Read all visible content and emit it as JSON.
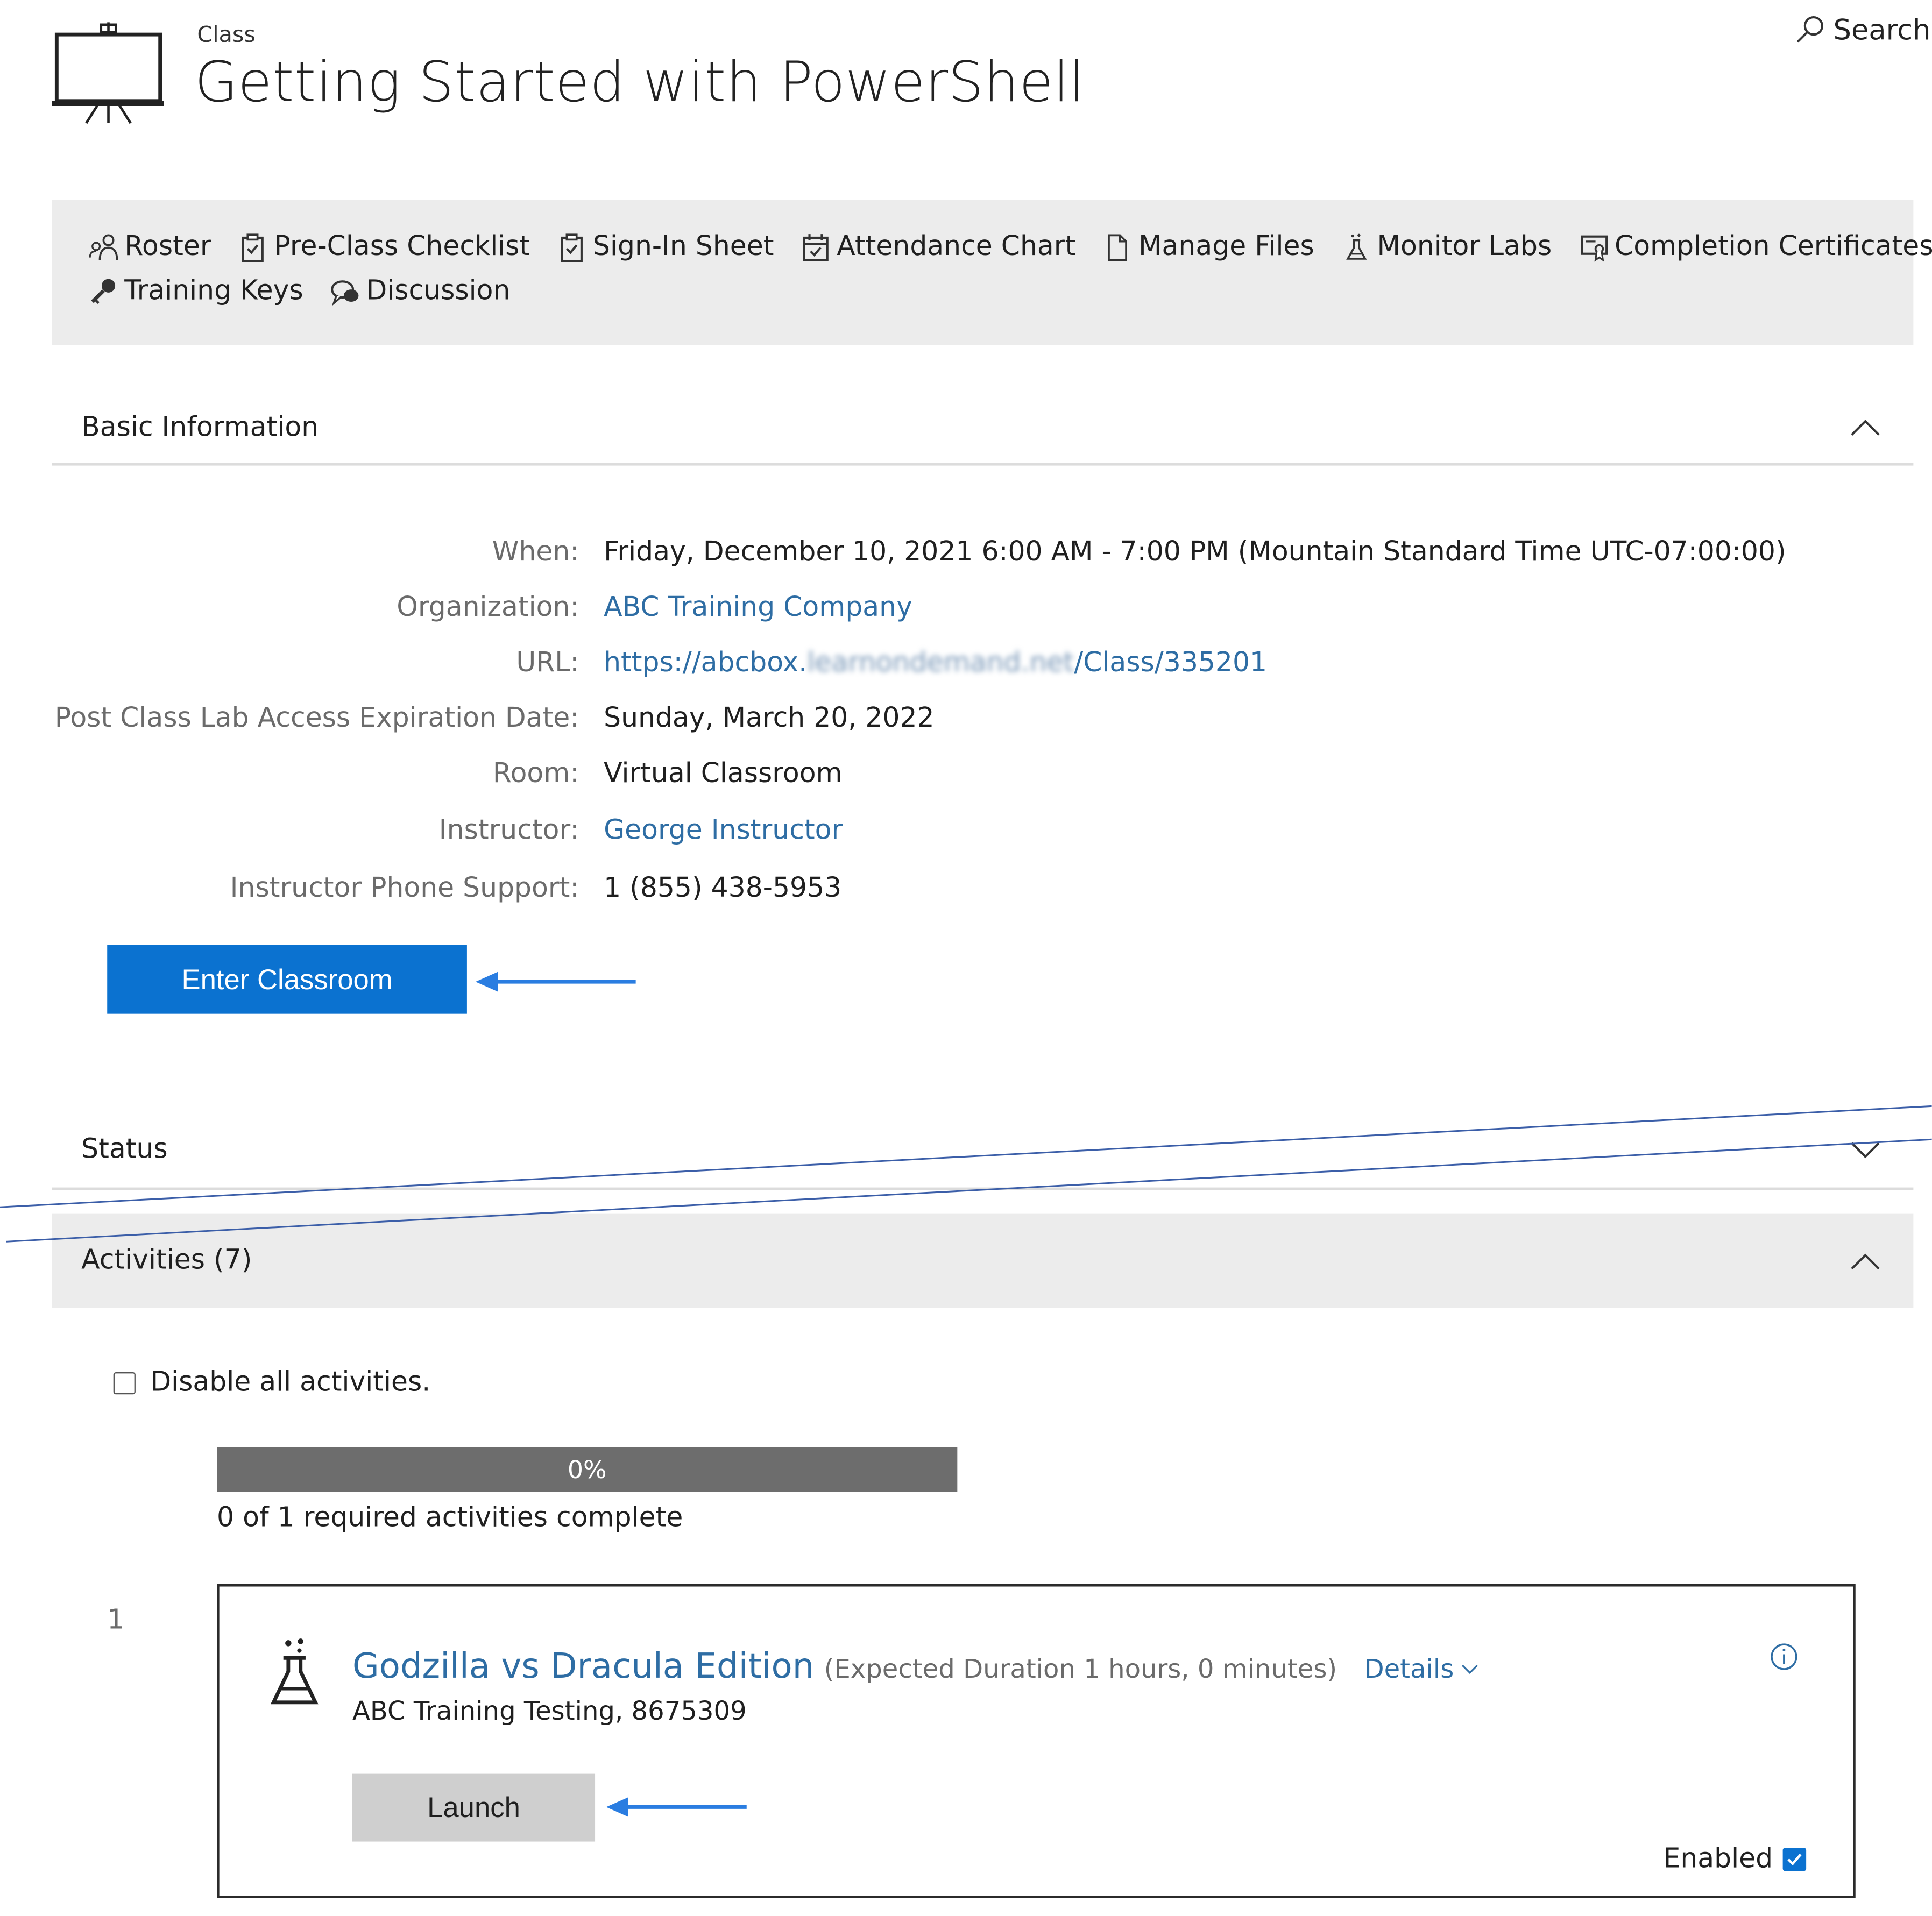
{
  "header": {
    "kicker": "Class",
    "title": "Getting Started with PowerShell",
    "search_label": "Search"
  },
  "toolbar": {
    "items": [
      {
        "label": "Roster",
        "icon": "roster-icon"
      },
      {
        "label": "Pre-Class Checklist",
        "icon": "clipboard-check-icon"
      },
      {
        "label": "Sign-In Sheet",
        "icon": "clipboard-check-icon"
      },
      {
        "label": "Attendance Chart",
        "icon": "calendar-check-icon"
      },
      {
        "label": "Manage Files",
        "icon": "file-icon"
      },
      {
        "label": "Monitor Labs",
        "icon": "flask-icon"
      },
      {
        "label": "Completion Certificates",
        "icon": "certificate-icon"
      },
      {
        "label": "Training Keys",
        "icon": "key-icon"
      },
      {
        "label": "Discussion",
        "icon": "chat-bubbles-icon"
      }
    ]
  },
  "basic_info": {
    "title": "Basic Information",
    "rows": [
      {
        "label": "When:",
        "value": "Friday, December 10, 2021 6:00 AM - 7:00 PM (Mountain Standard Time UTC-07:00:00)"
      },
      {
        "label": "Organization:",
        "value": "ABC Training Company"
      },
      {
        "label": "URL:",
        "value_prefix": "https://abcbox.",
        "value_blurred": "learnondemand.net",
        "value_suffix": "/Class/335201"
      },
      {
        "label": "Post Class Lab Access Expiration Date:",
        "value": "Sunday, March 20, 2022"
      },
      {
        "label": "Room:",
        "value": "Virtual Classroom"
      },
      {
        "label": "Instructor:",
        "value": "George Instructor"
      },
      {
        "label": "Instructor Phone Support:",
        "value": "1 (855) 438-5953"
      }
    ],
    "enter_button": "Enter Classroom"
  },
  "status": {
    "title": "Status"
  },
  "activities": {
    "title": "Activities (7)",
    "disable_label": "Disable all activities.",
    "progress_fraction": 0,
    "progress_text": "0%",
    "progress_caption": "0 of 1 required activities complete",
    "items": [
      {
        "number": "1",
        "title": "Godzilla vs Dracula Edition",
        "duration": "(Expected Duration 1 hours, 0 minutes)",
        "details_label": "Details",
        "subtitle": "ABC Training Testing, 8675309",
        "launch_label": "Launch",
        "enabled_label": "Enabled",
        "enabled": true
      }
    ]
  },
  "colors": {
    "accent": "#0b72d0",
    "link": "#2e6da4",
    "toolbar_bg": "#ececec",
    "progress_bg": "#6d6d6d",
    "annotation_arrow": "#2a7de1"
  }
}
